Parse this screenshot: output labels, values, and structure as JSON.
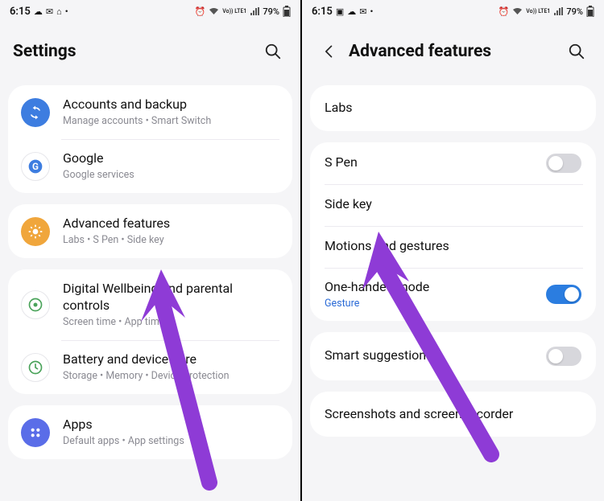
{
  "status": {
    "time": "6:15",
    "battery": "79%",
    "net_label": "Vo)) LTE1"
  },
  "left": {
    "title": "Settings",
    "items": [
      {
        "icon": "sync-icon",
        "label": "Accounts and backup",
        "sub": "Manage accounts  •  Smart Switch"
      },
      {
        "icon": "google-icon",
        "label": "Google",
        "sub": "Google services"
      },
      {
        "icon": "advanced-icon",
        "label": "Advanced features",
        "sub": "Labs  •  S Pen  •  Side key"
      },
      {
        "icon": "wellbeing-icon",
        "label": "Digital Wellbeing and parental controls",
        "sub": "Screen time  •  App timers"
      },
      {
        "icon": "battery-icon",
        "label": "Battery and device care",
        "sub": "Storage  •  Memory  •  Device protection"
      },
      {
        "icon": "apps-icon",
        "label": "Apps",
        "sub": "Default apps  •  App settings"
      }
    ]
  },
  "right": {
    "title": "Advanced features",
    "rows": [
      {
        "label": "Labs",
        "type": "plain"
      },
      {
        "label": "S Pen",
        "type": "toggle",
        "on": false
      },
      {
        "label": "Side key",
        "type": "plain"
      },
      {
        "label": "Motions and gestures",
        "type": "plain"
      },
      {
        "label": "One-handed mode",
        "sublink": "Gesture",
        "type": "toggle",
        "on": true
      },
      {
        "label": "Smart suggestions",
        "type": "toggle",
        "on": false
      },
      {
        "label": "Screenshots and screen recorder",
        "type": "plain"
      }
    ]
  },
  "arrow_color": "#8e3bd6"
}
